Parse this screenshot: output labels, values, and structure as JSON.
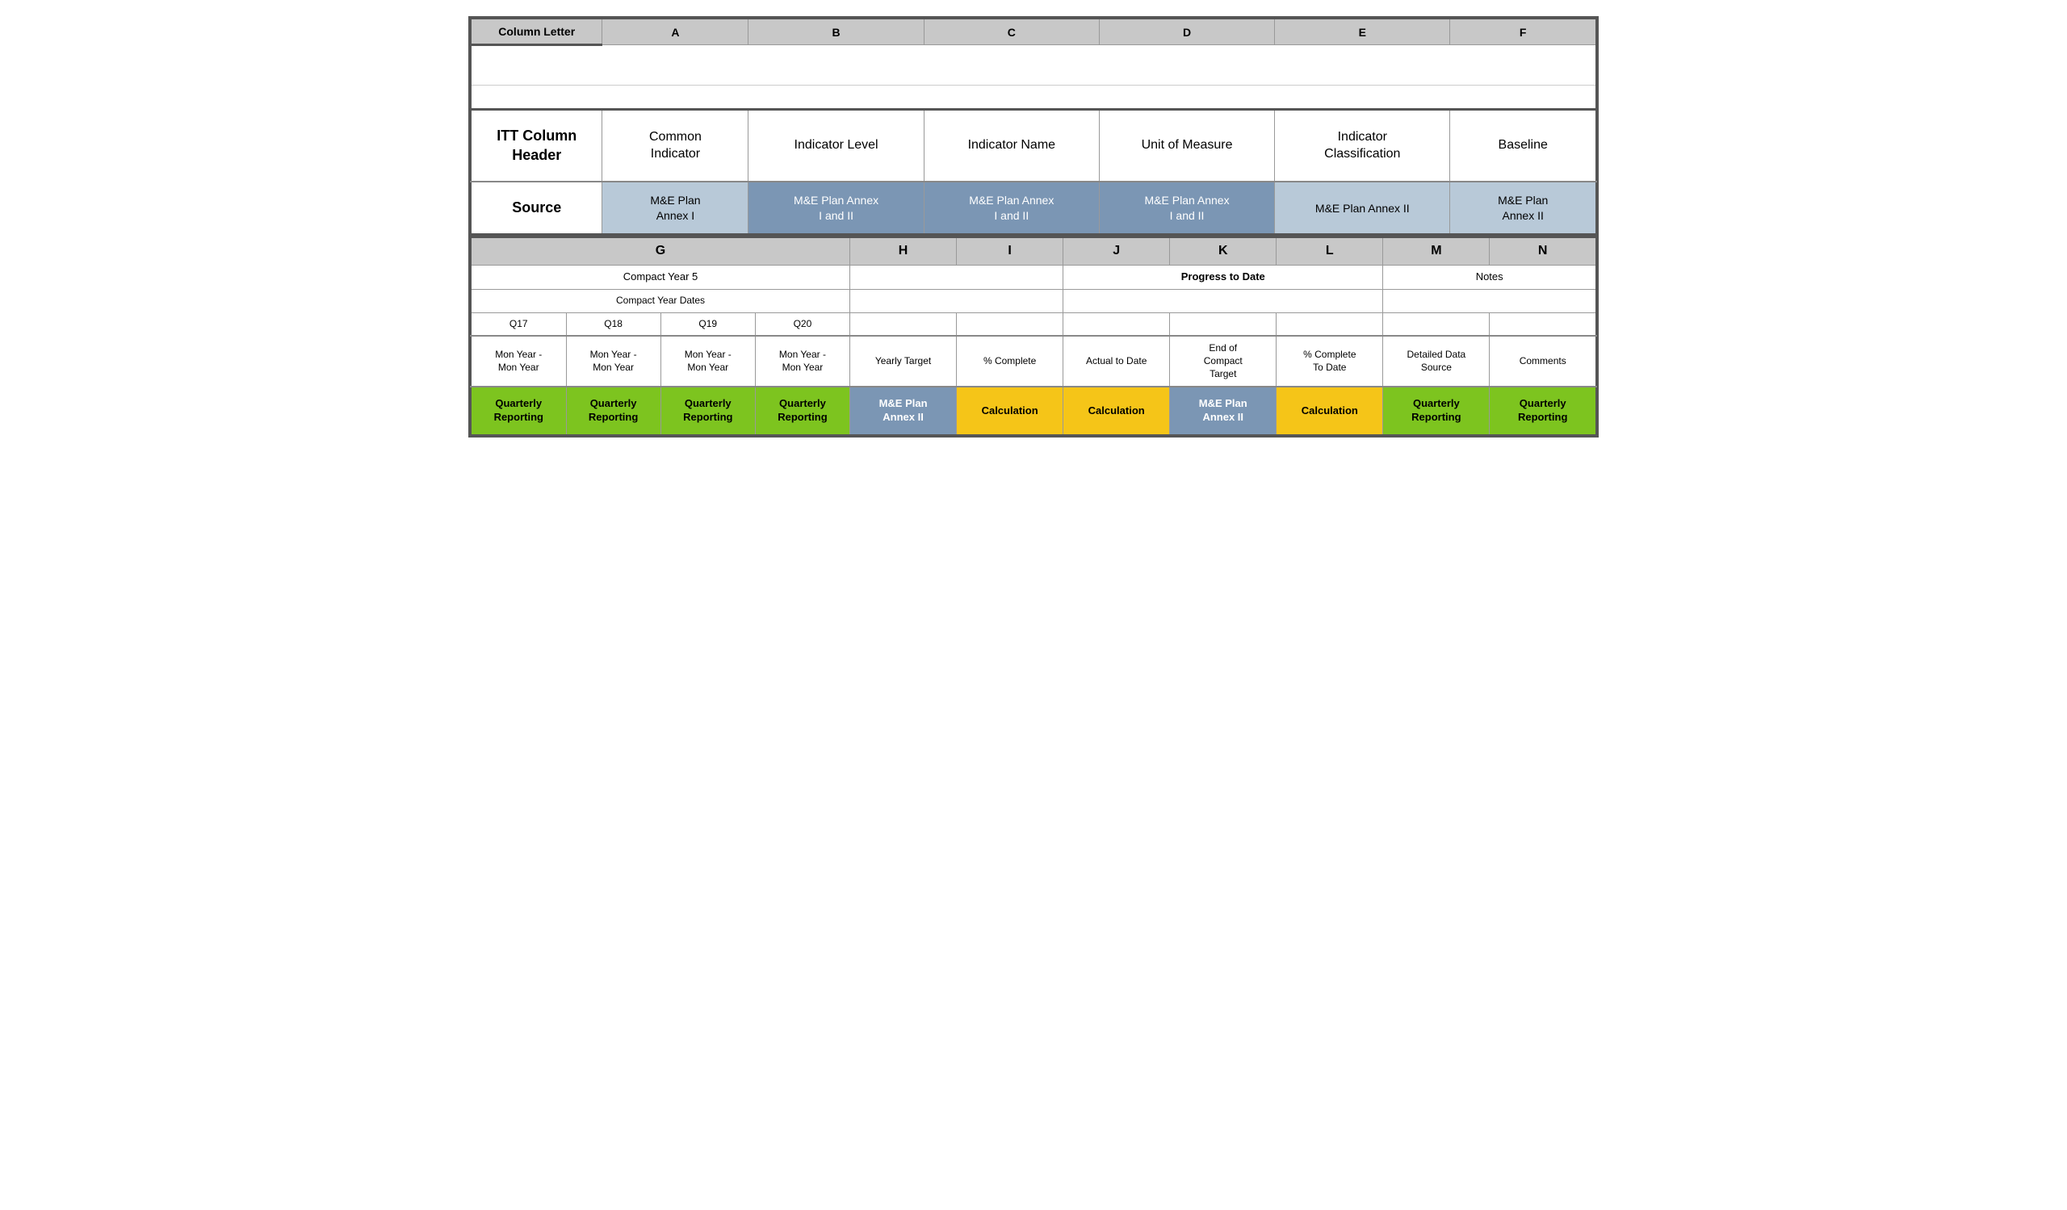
{
  "header": {
    "col_letter": "Column\nLetter",
    "col_a": "A",
    "col_b": "B",
    "col_c": "C",
    "col_d": "D",
    "col_e": "E",
    "col_f": "F"
  },
  "itt_header": {
    "label": "ITT Column\nHeader",
    "a": "Common\nIndicator",
    "b": "Indicator Level",
    "c": "Indicator Name",
    "d": "Unit of Measure",
    "e": "Indicator\nClassification",
    "f": "Baseline"
  },
  "source": {
    "label": "Source",
    "a": "M&E Plan\nAnnex I",
    "b": "M&E Plan Annex\nI and II",
    "c": "M&E Plan Annex\nI and II",
    "d": "M&E Plan Annex\nI and II",
    "e": "M&E Plan Annex II",
    "f": "M&E Plan\nAnnex II"
  },
  "bottom_cols": {
    "g": "G",
    "h": "H",
    "i": "I",
    "j": "J",
    "k": "K",
    "l": "L",
    "m": "M",
    "n": "N"
  },
  "compact_year": {
    "label": "Compact Year 5",
    "dates_label": "Compact Year Dates",
    "q17": "Q17",
    "q18": "Q18",
    "q19": "Q19",
    "q20": "Q20"
  },
  "progress": {
    "label": "Progress to Date"
  },
  "notes": {
    "label": "Notes"
  },
  "date_range": "Mon Year -\nMon Year",
  "yearly_target": "Yearly Target",
  "pct_complete": "% Complete",
  "actual_to_date": "Actual to Date",
  "end_compact_target": "End of\nCompact\nTarget",
  "pct_complete_to_date": "% Complete\nTo Date",
  "detailed_data_source": "Detailed Data\nSource",
  "comments": "Comments",
  "source_bottom": {
    "quarterly": "Quarterly\nReporting",
    "mne_annex2": "M&E Plan\nAnnex II",
    "calculation": "Calculation"
  }
}
